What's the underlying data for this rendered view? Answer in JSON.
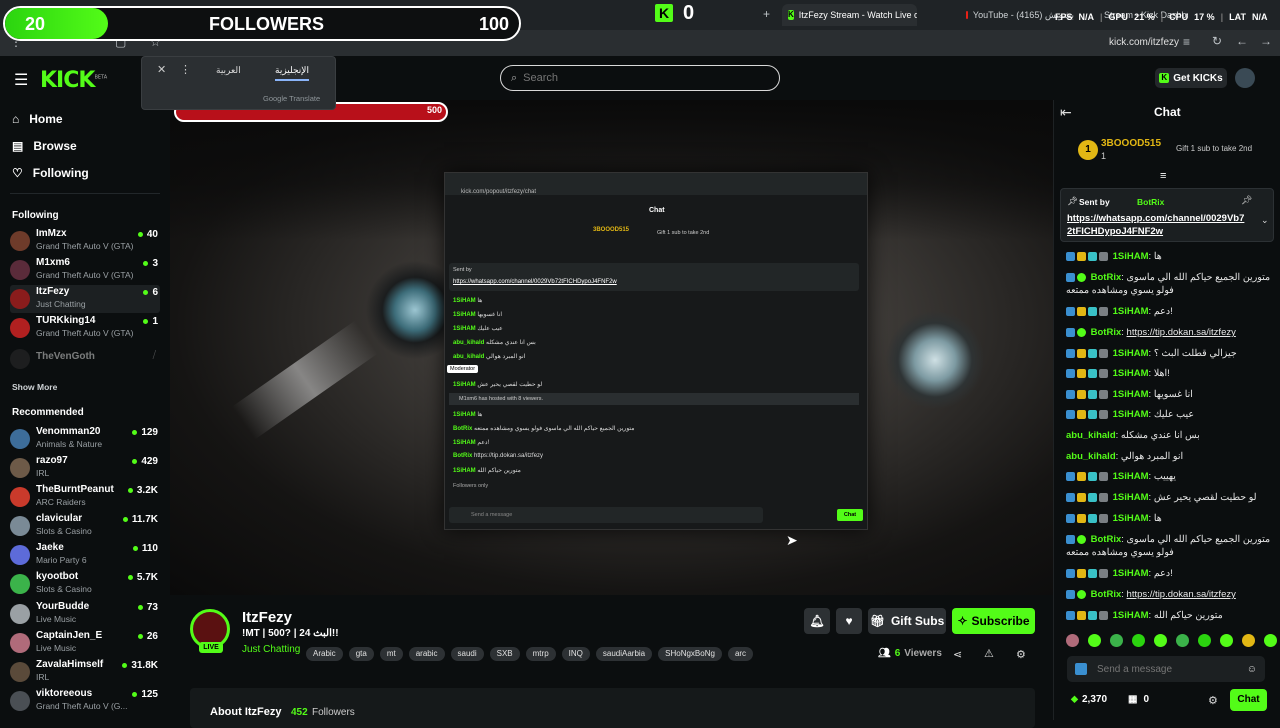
{
  "browser": {
    "tabs": [
      {
        "label": "ItzFezy Stream - Watch Live on",
        "active": true
      },
      {
        "label": "YouTube - بشويش (4165)",
        "active": false
      },
      {
        "label": "Stream - Kick Dashboard",
        "active": false
      }
    ],
    "url": "kick.com/itzfezy",
    "kick_counter": "0"
  },
  "perf_overlay": {
    "fps_label": "FPS",
    "fps_value": "N/A",
    "gpu_label": "GPU",
    "gpu_value": "21 %",
    "cpu_label": "CPU",
    "cpu_value": "17 %",
    "lat_label": "LAT",
    "lat_value": "N/A"
  },
  "followers_goal": {
    "current": "20",
    "title": "FOLLOWERS",
    "target": "100",
    "progress": 0.2
  },
  "mini_meter": {
    "right_value": "500"
  },
  "translate_popup": {
    "lang_a": "العربية",
    "lang_b": "الإنجليزية",
    "footer": "Google Translate"
  },
  "header": {
    "logo_text": "KICK",
    "logo_badge": "BETA",
    "search_placeholder": "Search",
    "get_kicks_label": "Get KICKs"
  },
  "sidebar": {
    "nav": [
      {
        "label": "Home",
        "icon": "home-icon"
      },
      {
        "label": "Browse",
        "icon": "browse-icon"
      },
      {
        "label": "Following",
        "icon": "heart-icon"
      }
    ],
    "following_title": "Following",
    "following": [
      {
        "name": "ImMzx",
        "game": "Grand Theft Auto V (GTA)",
        "viewers": "40",
        "color": "#6e3b2a"
      },
      {
        "name": "M1xm6",
        "game": "Grand Theft Auto V (GTA)",
        "viewers": "3",
        "color": "#5a2b3a"
      },
      {
        "name": "ItzFezy",
        "game": "Just Chatting",
        "viewers": "6",
        "color": "#8a1c1c"
      },
      {
        "name": "TURKking14",
        "game": "Grand Theft Auto V (GTA)",
        "viewers": "1",
        "color": "#b12020"
      },
      {
        "name": "TheVenGoth",
        "game": "",
        "viewers": "",
        "color": "#333"
      }
    ],
    "show_more": "Show More",
    "recommended_title": "Recommended",
    "recommended": [
      {
        "name": "Venomman20",
        "game": "Animals & Nature",
        "viewers": "129",
        "color": "#3d6d9a"
      },
      {
        "name": "razo97",
        "game": "IRL",
        "viewers": "429",
        "color": "#6d5a48"
      },
      {
        "name": "TheBurntPeanut",
        "game": "ARC Raiders",
        "viewers": "3.2K",
        "color": "#c93a2b"
      },
      {
        "name": "clavicular",
        "game": "Slots & Casino",
        "viewers": "11.7K",
        "color": "#7a8a96"
      },
      {
        "name": "Jaeke",
        "game": "Mario Party 6",
        "viewers": "110",
        "color": "#5d6bd9"
      },
      {
        "name": "kyootbot",
        "game": "Slots & Casino",
        "viewers": "5.7K",
        "color": "#3bb34a"
      },
      {
        "name": "YourBudde",
        "game": "Live Music",
        "viewers": "73",
        "color": "#9aa0a4"
      },
      {
        "name": "CaptainJen_E",
        "game": "Live Music",
        "viewers": "26",
        "color": "#b06b7a"
      },
      {
        "name": "ZavalaHimself",
        "game": "IRL",
        "viewers": "31.8K",
        "color": "#5a4a3a"
      },
      {
        "name": "viktoreeous",
        "game": "Grand Theft Auto V (G...",
        "viewers": "125",
        "color": "#4a4f54"
      }
    ]
  },
  "channel": {
    "name": "ItzFezy",
    "live_badge": "LIVE",
    "title": "!MT | 500? | البث 24!!",
    "category": "Just Chatting",
    "tags": [
      "Arabic",
      "gta",
      "mt",
      "arabic",
      "saudi",
      "SXB",
      "mtrp",
      "INQ",
      "saudiAarbia",
      "SHoNgxBoNg",
      "arc"
    ],
    "viewers_count": "6",
    "viewers_label": "Viewers",
    "gift_subs_label": "Gift Subs",
    "subscribe_label": "Subscribe",
    "about_title": "About ItzFezy",
    "followers_count": "452",
    "followers_label": "Followers"
  },
  "chat": {
    "title": "Chat",
    "top_gifter": {
      "rank": "1",
      "name": "3BOOOD515",
      "count": "1",
      "gift_text": "Gift 1 sub to take 2nd"
    },
    "pinned": {
      "sent_by_label": "Sent by",
      "sender": "BotRix",
      "link": "https://whatsapp.com/channel/0029Vb72tFICHDypoJ4FNF2w"
    },
    "messages": [
      {
        "user": "1SiHAM",
        "text": "ها",
        "badges": true,
        "color": "#53fc18"
      },
      {
        "user": "BotRix",
        "text": "متورين الجميع حياكم الله الي ماسوى فولو يسوي ومشاهده ممتعه",
        "badges": true,
        "color": "#53fc18"
      },
      {
        "user": "1SiHAM",
        "text": "دعم!",
        "badges": true,
        "color": "#53fc18"
      },
      {
        "user": "BotRix",
        "text": "https://tip.dokan.sa/itzfezy",
        "badges": true,
        "color": "#53fc18"
      },
      {
        "user": "1SiHAM",
        "text": "جيزالي قطلت البث ؟",
        "badges": true,
        "color": "#53fc18"
      },
      {
        "user": "1SiHAM",
        "text": "اهلا!",
        "badges": true,
        "color": "#53fc18"
      },
      {
        "user": "1SiHAM",
        "text": "انا غسويها",
        "badges": true,
        "color": "#53fc18"
      },
      {
        "user": "1SiHAM",
        "text": "عيب عليك",
        "badges": true,
        "color": "#53fc18"
      },
      {
        "user": "abu_kihald",
        "text": "بس انا عندي مشكله",
        "badges": false,
        "color": "#53fc18"
      },
      {
        "user": "abu_kihald",
        "text": "انو المبرد هوالي",
        "badges": false,
        "color": "#53fc18"
      },
      {
        "user": "1SiHAM",
        "text": "يهييب",
        "badges": true,
        "color": "#53fc18"
      },
      {
        "user": "1SiHAM",
        "text": "لو حطيت لقصي يحير عش",
        "badges": true,
        "color": "#53fc18"
      },
      {
        "user": "1SiHAM",
        "text": "ها",
        "badges": true,
        "color": "#53fc18"
      },
      {
        "user": "BotRix",
        "text": "متورين الجميع حياكم الله الي ماسوى فولو يسوي ومشاهده ممتعه",
        "badges": true,
        "color": "#53fc18"
      },
      {
        "user": "1SiHAM",
        "text": "دعم!",
        "badges": true,
        "color": "#53fc18"
      },
      {
        "user": "BotRix",
        "text": "https://tip.dokan.sa/itzfezy",
        "badges": true,
        "color": "#53fc18"
      },
      {
        "user": "1SiHAM",
        "text": "متورين حياكم الله",
        "badges": true,
        "color": "#53fc18"
      }
    ],
    "input_placeholder": "Send a message",
    "points": "2,370",
    "store_count": "0",
    "send_label": "Chat"
  },
  "inner_window": {
    "url": "kick.com/popout/itzfezy/chat",
    "title": "Chat",
    "tooltip": "Moderator",
    "hosted_text": "M1xm6 has hosted with 8 viewers.",
    "followers_only": "Followers only",
    "input_placeholder": "Send a message",
    "send_label": "Chat"
  }
}
